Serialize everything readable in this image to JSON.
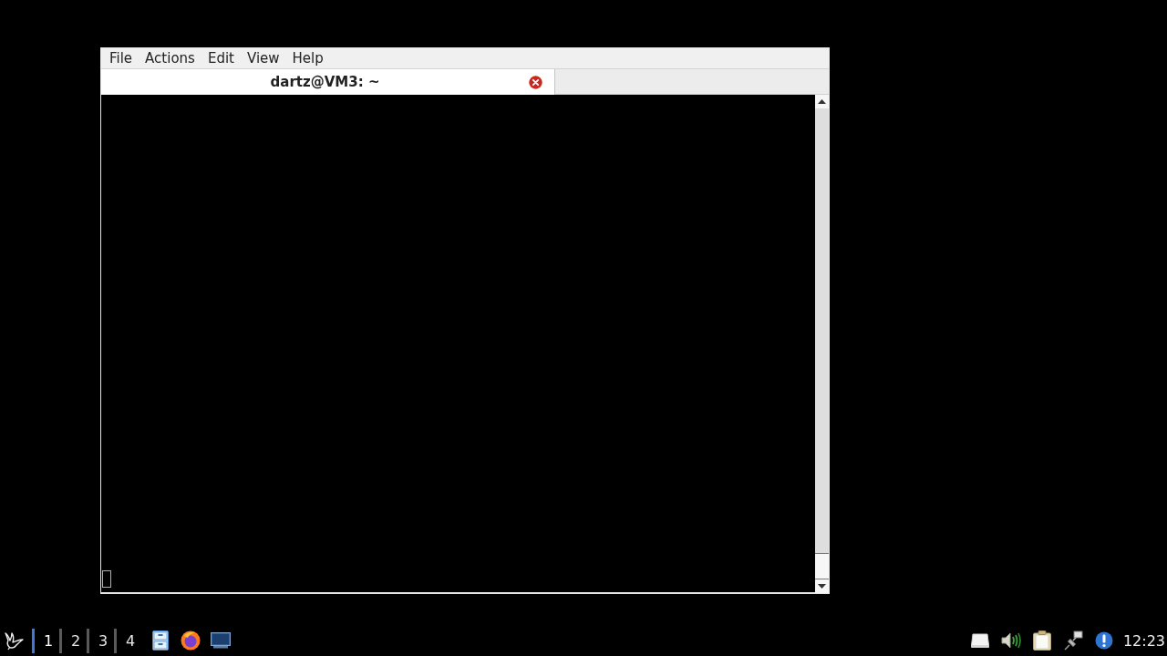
{
  "window": {
    "menu": [
      "File",
      "Actions",
      "Edit",
      "View",
      "Help"
    ],
    "tabs": [
      {
        "title": "dartz@VM3: ~",
        "selected": true
      }
    ]
  },
  "taskbar": {
    "workspaces": [
      {
        "label": "1",
        "selected": true
      },
      {
        "label": "2",
        "selected": false
      },
      {
        "label": "3",
        "selected": false
      },
      {
        "label": "4",
        "selected": false
      }
    ],
    "clock": "12:23"
  }
}
